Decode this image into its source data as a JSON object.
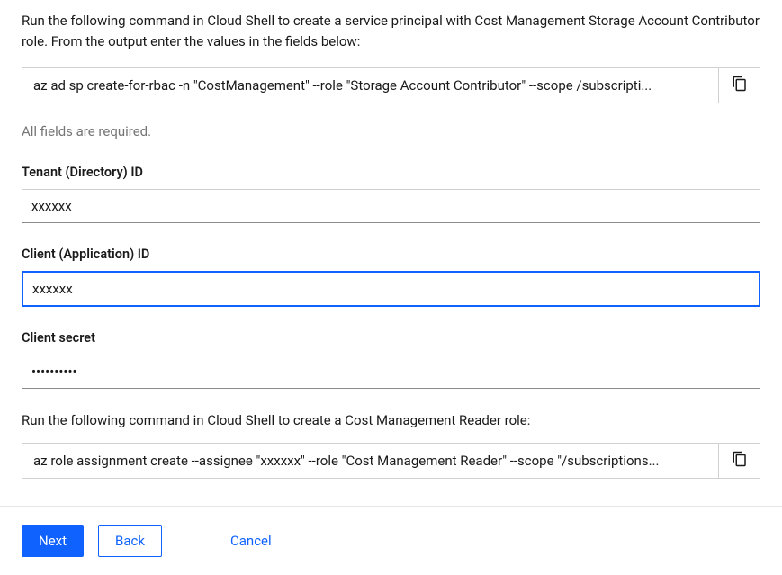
{
  "instruction1": "Run the following command in Cloud Shell to create a service principal with Cost Management Storage Account Contributor role. From the output enter the values in the fields below:",
  "command1": "az ad sp create-for-rbac -n \"CostManagement\" --role \"Storage Account Contributor\"  --scope /subscripti...",
  "helper_text": "All fields are required.",
  "fields": {
    "tenant": {
      "label": "Tenant (Directory) ID",
      "value": "xxxxxx"
    },
    "client": {
      "label": "Client (Application) ID",
      "value": "xxxxxx"
    },
    "secret": {
      "label": "Client secret",
      "value": "••••••••••"
    }
  },
  "instruction2": "Run the following command in Cloud Shell to create a Cost Management Reader role:",
  "command2": "az role assignment create --assignee \"xxxxxx\" --role \"Cost Management Reader\" --scope \"/subscriptions...",
  "footer": {
    "next": "Next",
    "back": "Back",
    "cancel": "Cancel"
  }
}
